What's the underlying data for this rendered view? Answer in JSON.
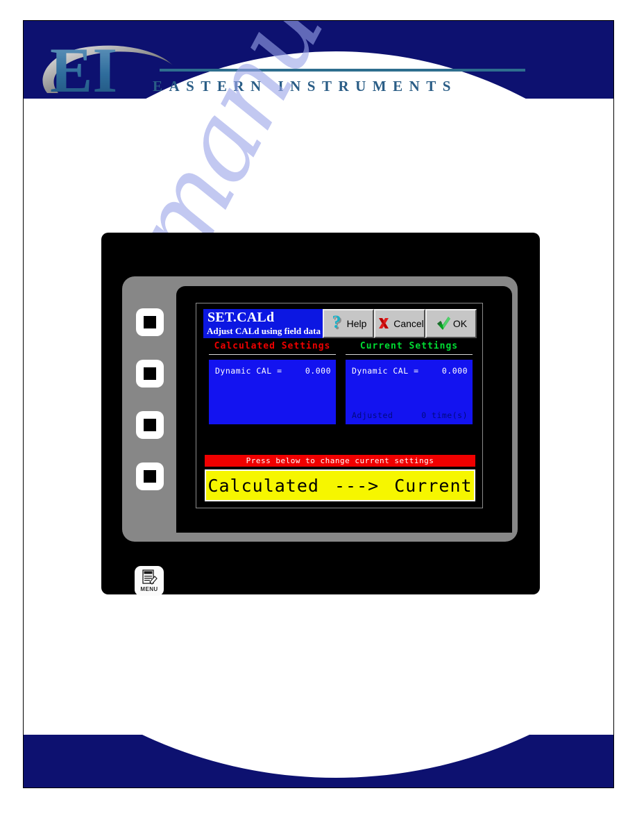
{
  "header": {
    "logo_initials": "EI",
    "company": "EASTERN INSTRUMENTS",
    "navy": "#0d1170",
    "accent_teal": "#2e6e8e",
    "logo_blue": "#2a5d86"
  },
  "watermark": {
    "text": "manualzz.com",
    "color": "#9aa4e8"
  },
  "device": {
    "softkeys": [
      {
        "name": "softkey-1"
      },
      {
        "name": "softkey-2"
      },
      {
        "name": "softkey-3"
      },
      {
        "name": "softkey-4"
      }
    ],
    "menu_key": {
      "label": "MENU",
      "icon": "document-pencil-icon"
    }
  },
  "screen": {
    "titlebar": {
      "title": "SET.CALd",
      "subtitle": "Adjust CALd using field data",
      "background": "#0c17e2",
      "buttons": [
        {
          "label": "Help",
          "icon": "question-mark-icon",
          "icon_color": "#18b2c8"
        },
        {
          "label": "Cancel",
          "icon": "red-x-icon",
          "icon_color": "#cc0000"
        },
        {
          "label": "OK",
          "icon": "green-check-icon",
          "icon_color": "#00a21f"
        }
      ]
    },
    "columns": [
      {
        "heading": "Calculated Settings",
        "heading_color": "#ee0000",
        "rows": [
          {
            "label": "Dynamic CAL =",
            "value": "0.000"
          }
        ],
        "footer": null
      },
      {
        "heading": "Current Settings",
        "heading_color": "#00dd33",
        "rows": [
          {
            "label": "Dynamic CAL =",
            "value": "0.000"
          }
        ],
        "footer": {
          "label": "Adjusted",
          "value": "0 time(s)"
        }
      }
    ],
    "prompt_banner": {
      "text": "Press below to change current settings",
      "background": "#f00000",
      "color": "#ffffff"
    },
    "action_button": {
      "left_text": "Calculated",
      "arrow": "--->",
      "right_text": "Current",
      "background": "#f6f600",
      "color": "#000000"
    }
  }
}
